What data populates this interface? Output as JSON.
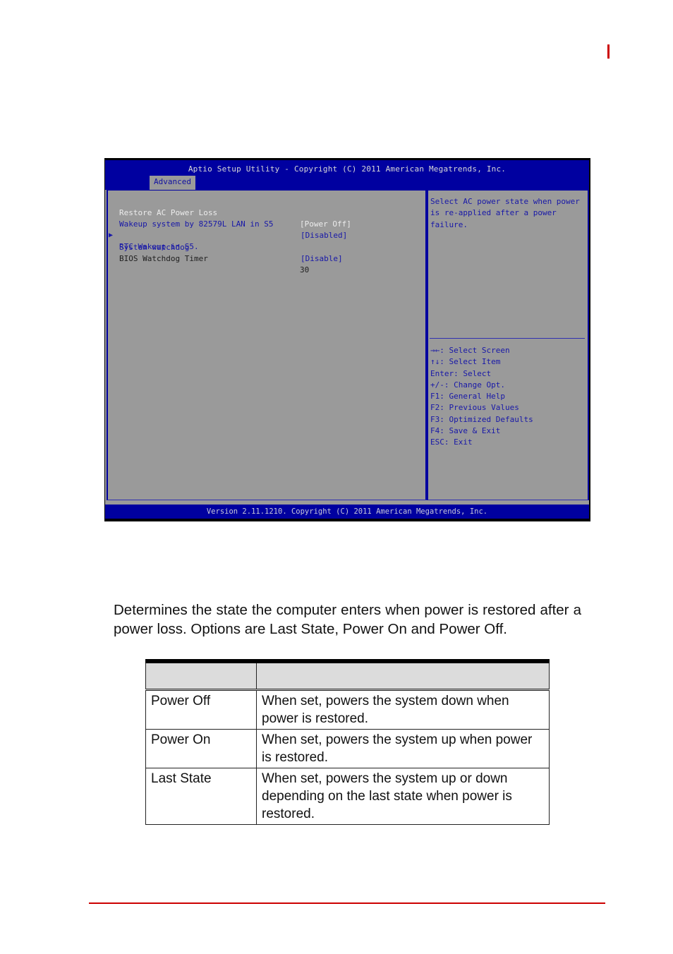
{
  "page": {
    "accent_color": "#cc0000"
  },
  "bios": {
    "title": "Aptio Setup Utility - Copyright (C) 2011 American Megatrends, Inc.",
    "active_tab": "Advanced",
    "settings": [
      {
        "label": "Restore AC Power Loss",
        "value": "[Power Off]",
        "state": "selected"
      },
      {
        "label": "Wakeup system by 82579L LAN in S5",
        "value": "[Disabled]",
        "state": "normal"
      },
      {
        "label": "RTC Wakeup in S5.",
        "value": "",
        "state": "submenu"
      },
      {
        "label": "System watchdog",
        "value": "[Disable]",
        "state": "normal"
      },
      {
        "label": "BIOS Watchdog Timer",
        "value": "30",
        "state": "readonly"
      }
    ],
    "submenu_pointer_icon": "triangle-right-icon",
    "help_text": "Select AC power state when power is re-applied after a power failure.",
    "key_help": [
      "→←: Select Screen",
      "↑↓: Select Item",
      "Enter: Select",
      "+/-: Change Opt.",
      "F1: General Help",
      "F2: Previous Values",
      "F3: Optimized Defaults",
      "F4: Save & Exit",
      "ESC: Exit"
    ],
    "footer": "Version 2.11.1210. Copyright (C) 2011 American Megatrends, Inc.",
    "colors": {
      "header_blue": "#0000a0",
      "body_gray": "#9a9a9a",
      "text_blue": "#1818a8",
      "text_white": "#ececec"
    }
  },
  "description": "Determines the state the computer enters when power is restored after a power loss. Options are Last State, Power On and Power Off.",
  "options_table": {
    "headers": [
      "",
      ""
    ],
    "rows": [
      {
        "option": "Power Off",
        "description": "When set, powers the system down when power is restored."
      },
      {
        "option": "Power On",
        "description": "When set, powers the system up when power is restored."
      },
      {
        "option": "Last State",
        "description": "When set, powers the system up or down depending on the last state when power is restored."
      }
    ]
  }
}
